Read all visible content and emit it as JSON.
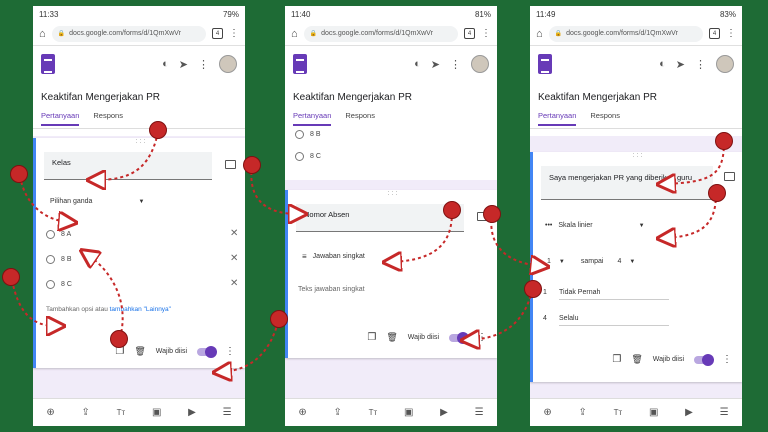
{
  "phones": [
    {
      "time": "11:33",
      "battery": "79%",
      "url": "docs.google.com/forms/d/1QmXwVr",
      "tab_count": "4",
      "title": "Keaktifan Mengerjakan PR",
      "tabs": [
        "Pertanyaan",
        "Respons"
      ],
      "question": "Kelas",
      "type": "Pilihan ganda",
      "options": [
        "8 A",
        "8 B",
        "8 C"
      ],
      "add_option": "Tambahkan opsi",
      "atau": "atau",
      "add_other": "tambahkan \"Lainnya\"",
      "required": "Wajib diisi"
    },
    {
      "time": "11:40",
      "battery": "81%",
      "url": "docs.google.com/forms/d/1QmXwVr",
      "tab_count": "4",
      "title": "Keaktifan Mengerjakan PR",
      "tabs": [
        "Pertanyaan",
        "Respons"
      ],
      "prev_options": [
        "8 B",
        "8 C"
      ],
      "question": "Nomor Absen",
      "type": "Jawaban singkat",
      "placeholder": "Teks jawaban singkat",
      "required": "Wajib diisi"
    },
    {
      "time": "11:49",
      "battery": "83%",
      "url": "docs.google.com/forms/d/1QmXwVr",
      "tab_count": "4",
      "title": "Keaktifan Mengerjakan PR",
      "tabs": [
        "Pertanyaan",
        "Respons"
      ],
      "question": "Saya mengerjakan PR yang diberikan guru",
      "type": "Skala linier",
      "scale_from": "1",
      "scale_to_word": "sampai",
      "scale_to": "4",
      "label1_num": "1",
      "label1": "Tidak Pernah",
      "label4_num": "4",
      "label4": "Selalu",
      "required": "Wajib diisi"
    }
  ],
  "icons": {
    "lock": "🔒",
    "home": "⌂",
    "palette": "◐",
    "send": "➤",
    "more": "⋮",
    "copy": "❐",
    "trash": "🗑",
    "close": "✕",
    "add": "⊕",
    "import": "⇪",
    "text": "Tт",
    "image": "▣",
    "video": "▶",
    "section": "☰"
  },
  "colors": {
    "background": "#1e6b35",
    "accent": "#673ab7",
    "marker": "#c62828"
  }
}
